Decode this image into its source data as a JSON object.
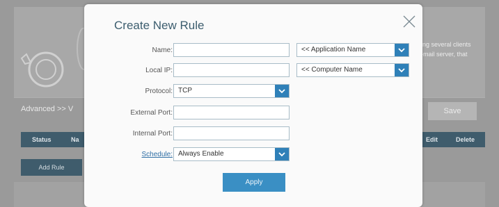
{
  "background": {
    "description_lines": [
      "ing several clients",
      "-mail server, that"
    ],
    "breadcrumb": "Advanced >> V",
    "save_label": "Save",
    "table_headers": {
      "status": "Status",
      "name": "Na",
      "edit": "Edit",
      "delete": "Delete"
    },
    "add_rule_label": "Add Rule"
  },
  "modal": {
    "title": "Create New Rule",
    "close_icon": "close-icon",
    "fields": {
      "name_label": "Name:",
      "name_value": "",
      "application_select": "<< Application Name",
      "local_ip_label": "Local IP:",
      "local_ip_value": "",
      "computer_select": "<< Computer Name",
      "protocol_label": "Protocol:",
      "protocol_value": "TCP",
      "external_port_label": "External Port:",
      "external_port_value": "",
      "internal_port_label": "Internal Port:",
      "internal_port_value": "",
      "schedule_label": "Schedule:",
      "schedule_value": "Always Enable"
    },
    "apply_label": "Apply"
  },
  "colors": {
    "accent": "#2f80b8",
    "title": "#3c5d6e",
    "table_header": "#3f5c6c"
  }
}
